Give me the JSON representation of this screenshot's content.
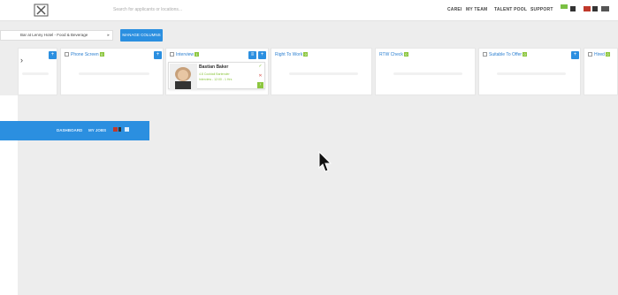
{
  "header": {
    "search_placeholder": "Search for applicants or locations...",
    "nav_items": [
      "CAREI",
      "MY TEAM",
      "TALENT POOL",
      "SUPPORT"
    ]
  },
  "toolbar": {
    "job_selector": "Bar at Lenny Hotel - Food & Beverage",
    "manage_columns": "MANAGE COLUMNS"
  },
  "columns": [
    {
      "name": "Phone Screen",
      "count": "0"
    },
    {
      "name": "Interview",
      "count": "1"
    },
    {
      "name": "Right To Work",
      "count": "0"
    },
    {
      "name": "RTW Check",
      "count": "0"
    },
    {
      "name": "Suitable To Offer",
      "count": "0"
    },
    {
      "name": "Hired",
      "count": "0"
    }
  ],
  "card": {
    "name": "Bastian Baker",
    "lines": [
      "4.8 Cocktail Bartender",
      "Interview - 12:00 - 1 Hrs"
    ]
  },
  "blue_bar": {
    "item1": "DASHBOARD",
    "item2": "MY JOBS"
  },
  "colors": {
    "accent": "#2b8fe0",
    "green": "#8cc63f"
  },
  "icons": [
    "logo-icon",
    "search-icon",
    "flag-icon",
    "plus-icon",
    "check-icon",
    "close-icon",
    "cursor-icon"
  ]
}
